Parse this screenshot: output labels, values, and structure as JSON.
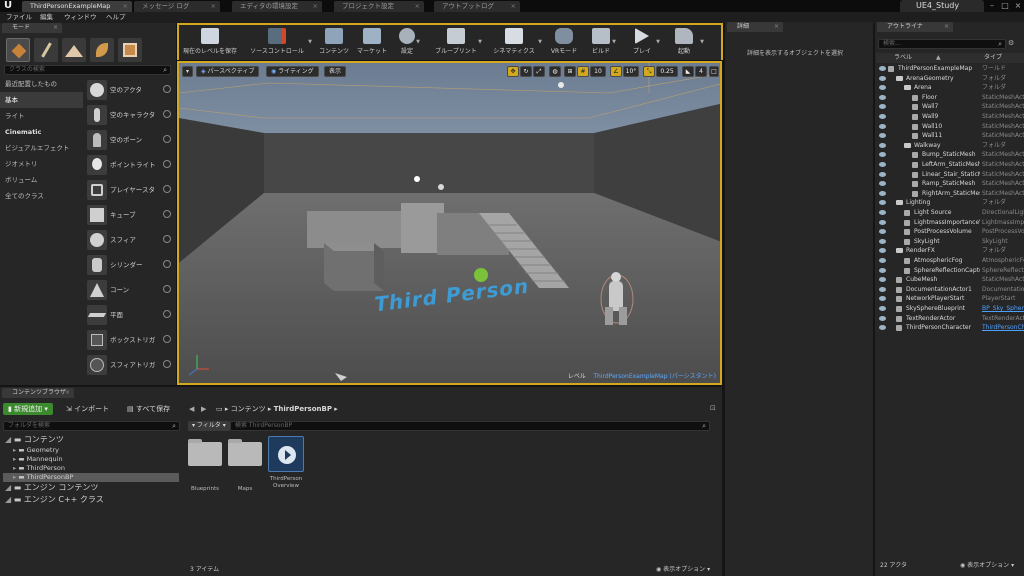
{
  "tabs": {
    "documents": [
      "ThirdPersonExampleMap",
      "メッセージ ログ",
      "エディタの環境設定",
      "プロジェクト設定",
      "アウトプットログ"
    ],
    "project": "UE4_Study"
  },
  "menu": [
    "ファイル",
    "編集",
    "ウィンドウ",
    "ヘルプ"
  ],
  "modes": {
    "tab_label": "モード",
    "search_placeholder": "クラスの検索",
    "categories": [
      "最近配置したもの",
      "基本",
      "ライト",
      "Cinematic",
      "ビジュアルエフェクト",
      "ジオメトリ",
      "ボリューム",
      "全てのクラス"
    ],
    "selected_category": "基本",
    "items": [
      "空のアクタ",
      "空のキャラクタ",
      "空のポーン",
      "ポイントライト",
      "プレイヤースタ",
      "キューブ",
      "スフィア",
      "シリンダー",
      "コーン",
      "平面",
      "ボックストリガ",
      "スフィアトリガ"
    ]
  },
  "toolbar": {
    "buttons": [
      "現在のレベルを保存",
      "ソースコントロール",
      "コンテンツ",
      "マーケット",
      "設定",
      "ブループリント",
      "シネマティクス",
      "VRモード",
      "ビルド",
      "プレイ",
      "起動"
    ]
  },
  "viewport": {
    "perspective": "パースペクティブ",
    "lighting": "ライティング",
    "show": "表示",
    "grid_snap": "10",
    "rotation_snap": "10°",
    "scale_snap": "0.25",
    "camera_speed": "4",
    "status_level": "レベル",
    "status_map": "ThirdPersonExampleMap (パーシスタント)",
    "world_text": "Third Person"
  },
  "details": {
    "tab_label": "詳細",
    "empty_message": "詳細を表示するオブジェクトを選択"
  },
  "outliner": {
    "tab_label": "アウトライナ",
    "search_placeholder": "検索...",
    "col_label": "ラベル",
    "col_type": "タイプ",
    "rows": [
      {
        "name": "ThirdPersonExampleMap",
        "type": "ワールド",
        "indent": 0
      },
      {
        "name": "ArenaGeometry",
        "type": "フォルダ",
        "indent": 1
      },
      {
        "name": "Arena",
        "type": "フォルダ",
        "indent": 2
      },
      {
        "name": "Floor",
        "type": "StaticMeshActor",
        "indent": 3
      },
      {
        "name": "Wall7",
        "type": "StaticMeshActor",
        "indent": 3
      },
      {
        "name": "Wall9",
        "type": "StaticMeshActor",
        "indent": 3
      },
      {
        "name": "Wall10",
        "type": "StaticMeshActor",
        "indent": 3
      },
      {
        "name": "Wall11",
        "type": "StaticMeshActor",
        "indent": 3
      },
      {
        "name": "Walkway",
        "type": "フォルダ",
        "indent": 2
      },
      {
        "name": "Bump_StaticMesh",
        "type": "StaticMeshActor",
        "indent": 3
      },
      {
        "name": "LeftArm_StaticMesh",
        "type": "StaticMeshActor",
        "indent": 3
      },
      {
        "name": "Linear_Stair_StaticMesh",
        "type": "StaticMeshActor",
        "indent": 3
      },
      {
        "name": "Ramp_StaticMesh",
        "type": "StaticMeshActor",
        "indent": 3
      },
      {
        "name": "RightArm_StaticMesh",
        "type": "StaticMeshActor",
        "indent": 3
      },
      {
        "name": "Lighting",
        "type": "フォルダ",
        "indent": 1
      },
      {
        "name": "Light Source",
        "type": "DirectionalLight",
        "indent": 2
      },
      {
        "name": "LightmassImportanceVolume",
        "type": "LightmassImportanceVolume",
        "indent": 2
      },
      {
        "name": "PostProcessVolume",
        "type": "PostProcessVolume",
        "indent": 2
      },
      {
        "name": "SkyLight",
        "type": "SkyLight",
        "indent": 2
      },
      {
        "name": "RenderFX",
        "type": "フォルダ",
        "indent": 1
      },
      {
        "name": "AtmosphericFog",
        "type": "AtmosphericFog",
        "indent": 2
      },
      {
        "name": "SphereReflectionCapture",
        "type": "SphereReflectionCapture",
        "indent": 2
      },
      {
        "name": "CubeMesh",
        "type": "StaticMeshActor",
        "indent": 1
      },
      {
        "name": "DocumentationActor1",
        "type": "DocumentationActor",
        "indent": 1
      },
      {
        "name": "NetworkPlayerStart",
        "type": "PlayerStart",
        "indent": 1
      },
      {
        "name": "SkySphereBlueprint",
        "type": "BP_Sky_Sphere",
        "indent": 1,
        "link": true
      },
      {
        "name": "TextRenderActor",
        "type": "TextRenderActor",
        "indent": 1
      },
      {
        "name": "ThirdPersonCharacter",
        "type": "ThirdPersonCharacter",
        "indent": 1,
        "link": true
      }
    ],
    "count": "22 アクタ",
    "view_options": "表示オプション"
  },
  "content_browser": {
    "tab_label": "コンテンツブラウザ",
    "add_new": "新規追加",
    "import": "インポート",
    "save_all": "すべて保存",
    "folder_search_placeholder": "フォルダを検索",
    "path": [
      "コンテンツ",
      "ThirdPersonBP"
    ],
    "filter_label": "フィルタ",
    "asset_search_placeholder": "検索 ThirdPersonBP",
    "tree": [
      {
        "label": "コンテンツ",
        "level": 0
      },
      {
        "label": "Geometry",
        "level": 1
      },
      {
        "label": "Mannequin",
        "level": 1
      },
      {
        "label": "ThirdPerson",
        "level": 1
      },
      {
        "label": "ThirdPersonBP",
        "level": 1,
        "selected": true
      },
      {
        "label": "エンジン コンテンツ",
        "level": 0
      },
      {
        "label": "エンジン C++ クラス",
        "level": 0
      }
    ],
    "assets": [
      "Blueprints",
      "Maps",
      "ThirdPerson Overview"
    ],
    "item_count": "3 アイテム",
    "view_options": "表示オプション"
  },
  "colors": {
    "accent_gold": "#d2a81e",
    "link_blue": "#4ea0ff",
    "add_green": "#3c8a2e"
  }
}
